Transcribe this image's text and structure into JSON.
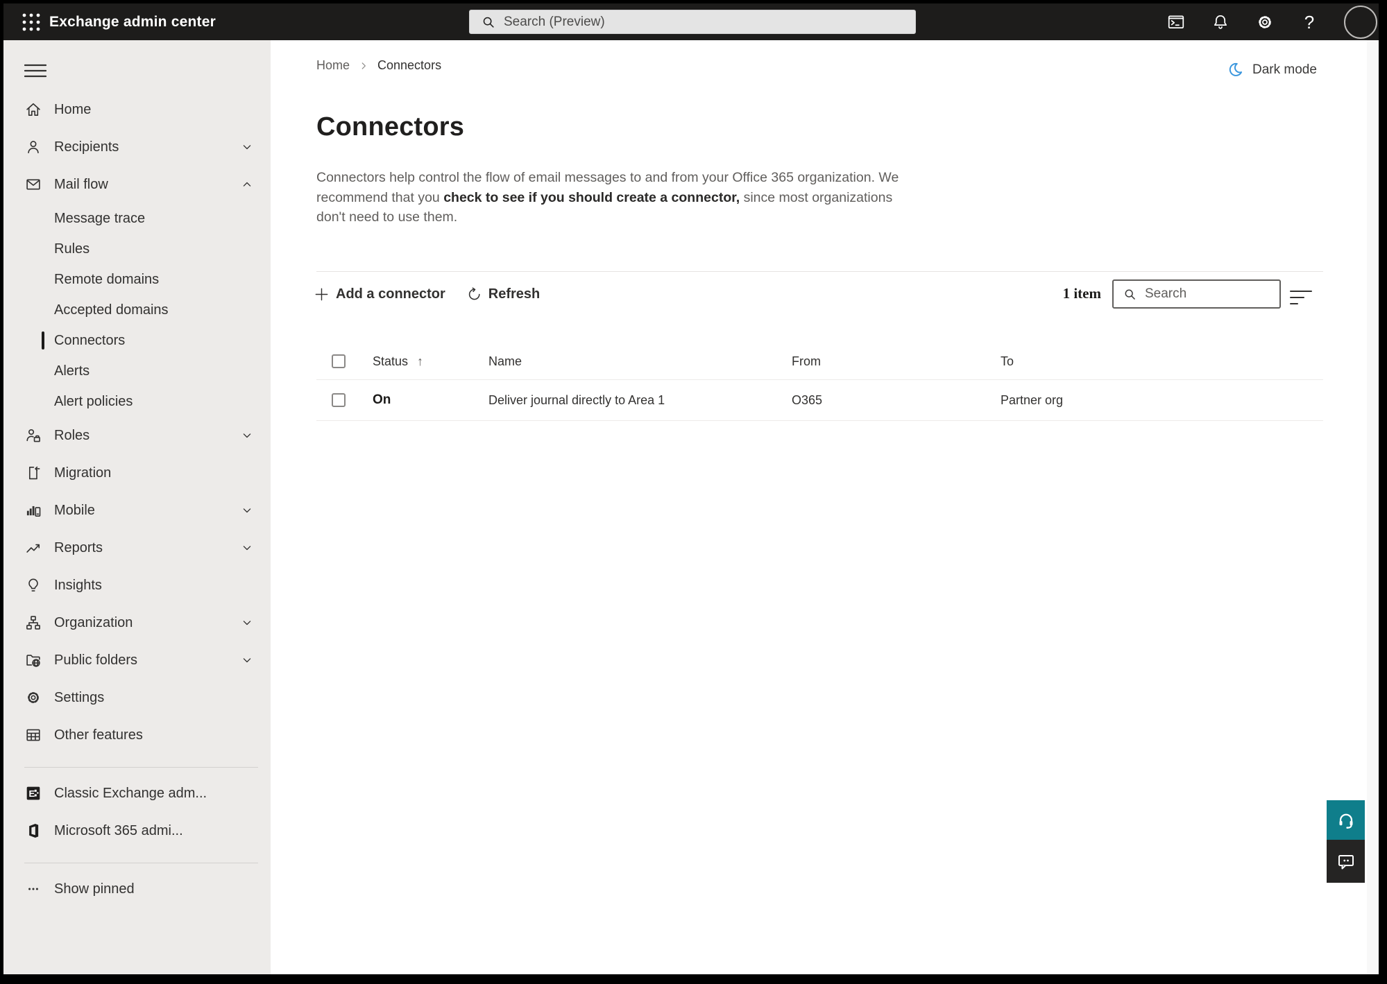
{
  "colors": {
    "topbar_bg": "#1d1c1b",
    "sidebar_bg": "#edebe9",
    "accent_teal": "#0f7e8b",
    "moon_blue": "#3a96dd",
    "selected_marker": "#1b1a19",
    "text_primary": "#323130",
    "text_secondary": "#605e5c"
  },
  "topbar": {
    "title": "Exchange admin center",
    "search_placeholder": "Search (Preview)"
  },
  "sidebar": {
    "items": [
      {
        "label": "Home"
      },
      {
        "label": "Recipients"
      },
      {
        "label": "Mail flow"
      },
      {
        "label": "Message trace"
      },
      {
        "label": "Rules"
      },
      {
        "label": "Remote domains"
      },
      {
        "label": "Accepted domains"
      },
      {
        "label": "Connectors",
        "selected": true
      },
      {
        "label": "Alerts"
      },
      {
        "label": "Alert policies"
      },
      {
        "label": "Roles"
      },
      {
        "label": "Migration"
      },
      {
        "label": "Mobile"
      },
      {
        "label": "Reports"
      },
      {
        "label": "Insights"
      },
      {
        "label": "Organization"
      },
      {
        "label": "Public folders"
      },
      {
        "label": "Settings"
      },
      {
        "label": "Other features"
      },
      {
        "label": "Classic Exchange adm..."
      },
      {
        "label": "Microsoft 365 admi..."
      },
      {
        "label": "Show pinned"
      }
    ]
  },
  "breadcrumb": {
    "home": "Home",
    "current": "Connectors"
  },
  "header": {
    "dark_mode_label": "Dark mode",
    "title": "Connectors",
    "description": {
      "text_before": "Connectors help control the flow of email messages to and from your Office 365 organization. We recommend that you ",
      "link_text": "check to see if you should create a connector,",
      "text_after": " since most organizations don't need to use them."
    }
  },
  "toolbar": {
    "add_label": "Add a connector",
    "refresh_label": "Refresh",
    "item_count": "1 item",
    "search_placeholder": "Search"
  },
  "table": {
    "headers": {
      "status": "Status",
      "name": "Name",
      "from": "From",
      "to": "To"
    },
    "rows": [
      {
        "status": "On",
        "name": "Deliver journal directly to Area 1",
        "from": "O365",
        "to": "Partner org"
      }
    ]
  }
}
